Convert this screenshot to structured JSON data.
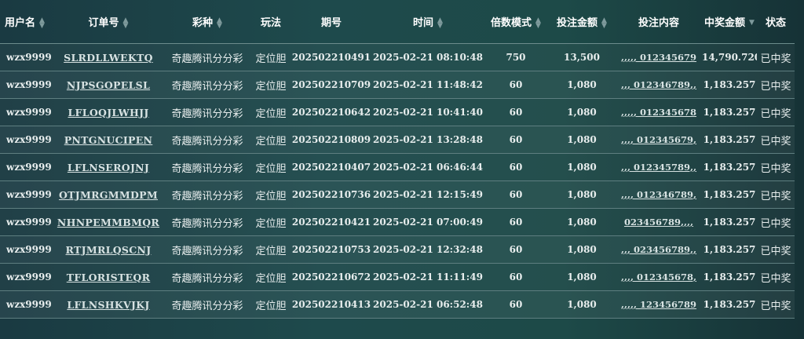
{
  "headers": {
    "user": "用户名",
    "order": "订单号",
    "lottery": "彩种",
    "play": "玩法",
    "issue": "期号",
    "time": "时间",
    "multiplier": "倍数模式",
    "bet_amount": "投注金额",
    "bet_content": "投注内容",
    "win_amount": "中奖金额",
    "status": "状态"
  },
  "sort_icons": {
    "up": "▲",
    "down": "▼"
  },
  "rows": [
    {
      "user": "wzx9999",
      "order": "SLRDLLWEKTQ",
      "lottery": "奇趣腾讯分分彩",
      "play": "定位胆",
      "issue": "202502210491",
      "time": "2025-02-21 08:10:48",
      "multiplier": "750",
      "bet_amount": "13,500",
      "bet_content": ",,,,, 012345679",
      "win_amount": "14,790.720",
      "status": "已中奖"
    },
    {
      "user": "wzx9999",
      "order": "NJPSGOPELSL",
      "lottery": "奇趣腾讯分分彩",
      "play": "定位胆",
      "issue": "202502210709",
      "time": "2025-02-21 11:48:42",
      "multiplier": "60",
      "bet_amount": "1,080",
      "bet_content": ",,, 012346789,,",
      "win_amount": "1,183.257",
      "status": "已中奖"
    },
    {
      "user": "wzx9999",
      "order": "LFLOQJLWHJJ",
      "lottery": "奇趣腾讯分分彩",
      "play": "定位胆",
      "issue": "202502210642",
      "time": "2025-02-21 10:41:40",
      "multiplier": "60",
      "bet_amount": "1,080",
      "bet_content": ",,,,, 012345678",
      "win_amount": "1,183.257",
      "status": "已中奖"
    },
    {
      "user": "wzx9999",
      "order": "PNTGNUCIPEN",
      "lottery": "奇趣腾讯分分彩",
      "play": "定位胆",
      "issue": "202502210809",
      "time": "2025-02-21 13:28:48",
      "multiplier": "60",
      "bet_amount": "1,080",
      "bet_content": ",,,, 012345679,",
      "win_amount": "1,183.257",
      "status": "已中奖"
    },
    {
      "user": "wzx9999",
      "order": "LFLNSEROJNJ",
      "lottery": "奇趣腾讯分分彩",
      "play": "定位胆",
      "issue": "202502210407",
      "time": "2025-02-21 06:46:44",
      "multiplier": "60",
      "bet_amount": "1,080",
      "bet_content": ",,, 012345789,,",
      "win_amount": "1,183.257",
      "status": "已中奖"
    },
    {
      "user": "wzx9999",
      "order": "OTJMRGMMDPM",
      "lottery": "奇趣腾讯分分彩",
      "play": "定位胆",
      "issue": "202502210736",
      "time": "2025-02-21 12:15:49",
      "multiplier": "60",
      "bet_amount": "1,080",
      "bet_content": ",,,, 012346789,",
      "win_amount": "1,183.257",
      "status": "已中奖"
    },
    {
      "user": "wzx9999",
      "order": "NHNPEMMBMQR",
      "lottery": "奇趣腾讯分分彩",
      "play": "定位胆",
      "issue": "202502210421",
      "time": "2025-02-21 07:00:49",
      "multiplier": "60",
      "bet_amount": "1,080",
      "bet_content": "023456789,,,,",
      "win_amount": "1,183.257",
      "status": "已中奖"
    },
    {
      "user": "wzx9999",
      "order": "RTJMRLQSCNJ",
      "lottery": "奇趣腾讯分分彩",
      "play": "定位胆",
      "issue": "202502210753",
      "time": "2025-02-21 12:32:48",
      "multiplier": "60",
      "bet_amount": "1,080",
      "bet_content": ",,, 023456789,,",
      "win_amount": "1,183.257",
      "status": "已中奖"
    },
    {
      "user": "wzx9999",
      "order": "TFLORISTEQR",
      "lottery": "奇趣腾讯分分彩",
      "play": "定位胆",
      "issue": "202502210672",
      "time": "2025-02-21 11:11:49",
      "multiplier": "60",
      "bet_amount": "1,080",
      "bet_content": ",,,, 012345678,",
      "win_amount": "1,183.257",
      "status": "已中奖"
    },
    {
      "user": "wzx9999",
      "order": "LFLNSHKVJKJ",
      "lottery": "奇趣腾讯分分彩",
      "play": "定位胆",
      "issue": "202502210413",
      "time": "2025-02-21 06:52:48",
      "multiplier": "60",
      "bet_amount": "1,080",
      "bet_content": ",,,,, 123456789",
      "win_amount": "1,183.257",
      "status": "已中奖"
    }
  ]
}
